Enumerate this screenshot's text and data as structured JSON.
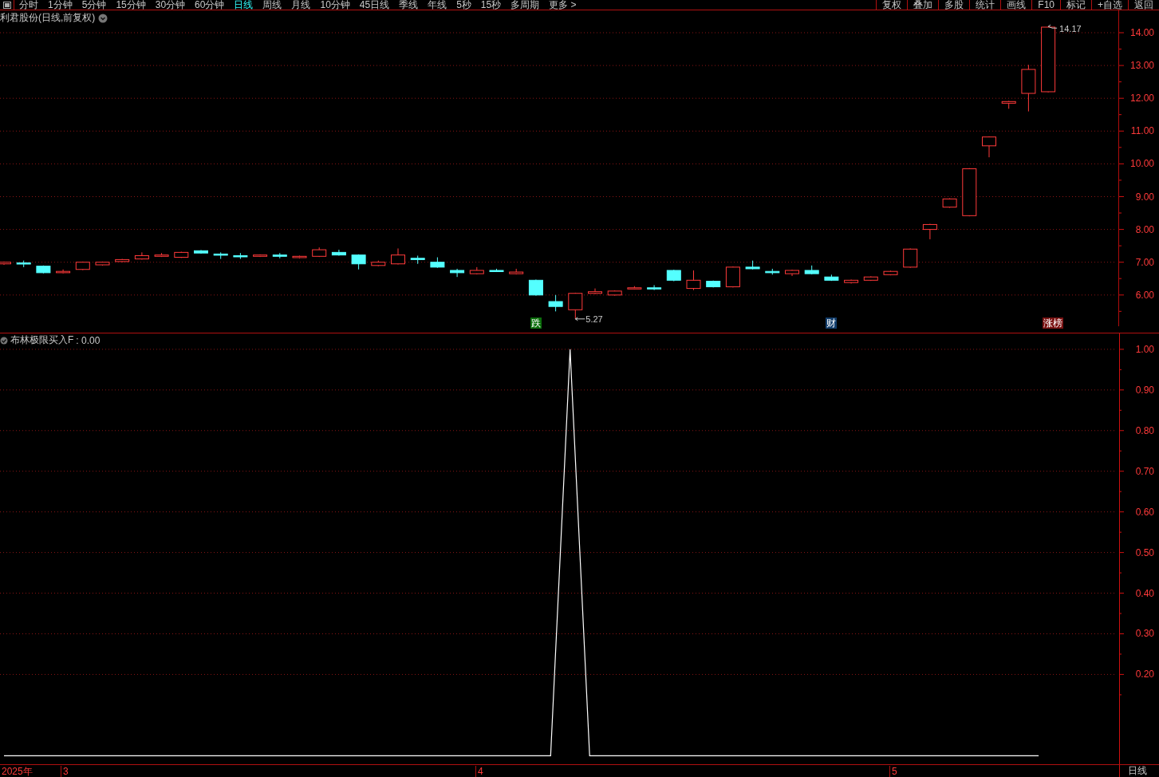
{
  "toolbar": {
    "periods": [
      {
        "label": "分时",
        "selected": false
      },
      {
        "label": "1分钟",
        "selected": false
      },
      {
        "label": "5分钟",
        "selected": false
      },
      {
        "label": "15分钟",
        "selected": false
      },
      {
        "label": "30分钟",
        "selected": false
      },
      {
        "label": "60分钟",
        "selected": false
      },
      {
        "label": "日线",
        "selected": true
      },
      {
        "label": "周线",
        "selected": false
      },
      {
        "label": "月线",
        "selected": false
      },
      {
        "label": "10分钟",
        "selected": false
      },
      {
        "label": "45日线",
        "selected": false
      },
      {
        "label": "季线",
        "selected": false
      },
      {
        "label": "年线",
        "selected": false
      },
      {
        "label": "5秒",
        "selected": false
      },
      {
        "label": "15秒",
        "selected": false
      },
      {
        "label": "多周期",
        "selected": false
      },
      {
        "label": "更多 >",
        "selected": false
      }
    ],
    "tools": [
      "复权",
      "叠加",
      "多股",
      "统计",
      "画线",
      "F10",
      "标记",
      "+自选",
      "返回"
    ]
  },
  "price_pane": {
    "title": "利君股份(日线,前复权)",
    "y_labels": [
      "14.00",
      "13.00",
      "12.00",
      "11.00",
      "10.00",
      "9.00",
      "8.00",
      "7.00",
      "6.00"
    ],
    "high_label": "14.17",
    "low_label": "5.27",
    "markers": [
      {
        "text": "跌",
        "color": "#0b6e0b"
      },
      {
        "text": "财",
        "color": "#123d6b"
      },
      {
        "text": "涨榜",
        "color": "#7a1212"
      }
    ]
  },
  "indicator_pane": {
    "reading": ": 0.00",
    "chart_data": {
      "type": "line",
      "ylim": [
        -0.02,
        1.04
      ],
      "grid": true,
      "yticks": [
        {
          "value": 1,
          "label": "1.00"
        },
        {
          "value": 0.9,
          "label": "0.90"
        },
        {
          "value": 0.8,
          "label": "0.80"
        },
        {
          "value": 0.7,
          "label": "0.70"
        },
        {
          "value": 0.6,
          "label": "0.60"
        },
        {
          "value": 0.5,
          "label": "0.50"
        },
        {
          "value": 0.4,
          "label": "0.40"
        },
        {
          "value": 0.3,
          "label": "0.30"
        },
        {
          "value": 0.2,
          "label": "0.20"
        }
      ],
      "series": [
        {
          "name": "布林极限买入F",
          "color": "#ffffff",
          "values": [
            0,
            0,
            0,
            0,
            0,
            0,
            0,
            0,
            0,
            0,
            0,
            0,
            0,
            0,
            0,
            0,
            0,
            0,
            0,
            0,
            0,
            0,
            0,
            0,
            0,
            0,
            0,
            0,
            0,
            1,
            0,
            0,
            0,
            0,
            0,
            0,
            0,
            0,
            0,
            0,
            0,
            0,
            0,
            0,
            0,
            0,
            0,
            0,
            0,
            0,
            0,
            0,
            0,
            0,
            null,
            null,
            null,
            null
          ]
        }
      ]
    }
  },
  "time_axis": {
    "labels": [
      "2025年",
      "3",
      "4",
      "5"
    ],
    "period": "日线"
  }
}
